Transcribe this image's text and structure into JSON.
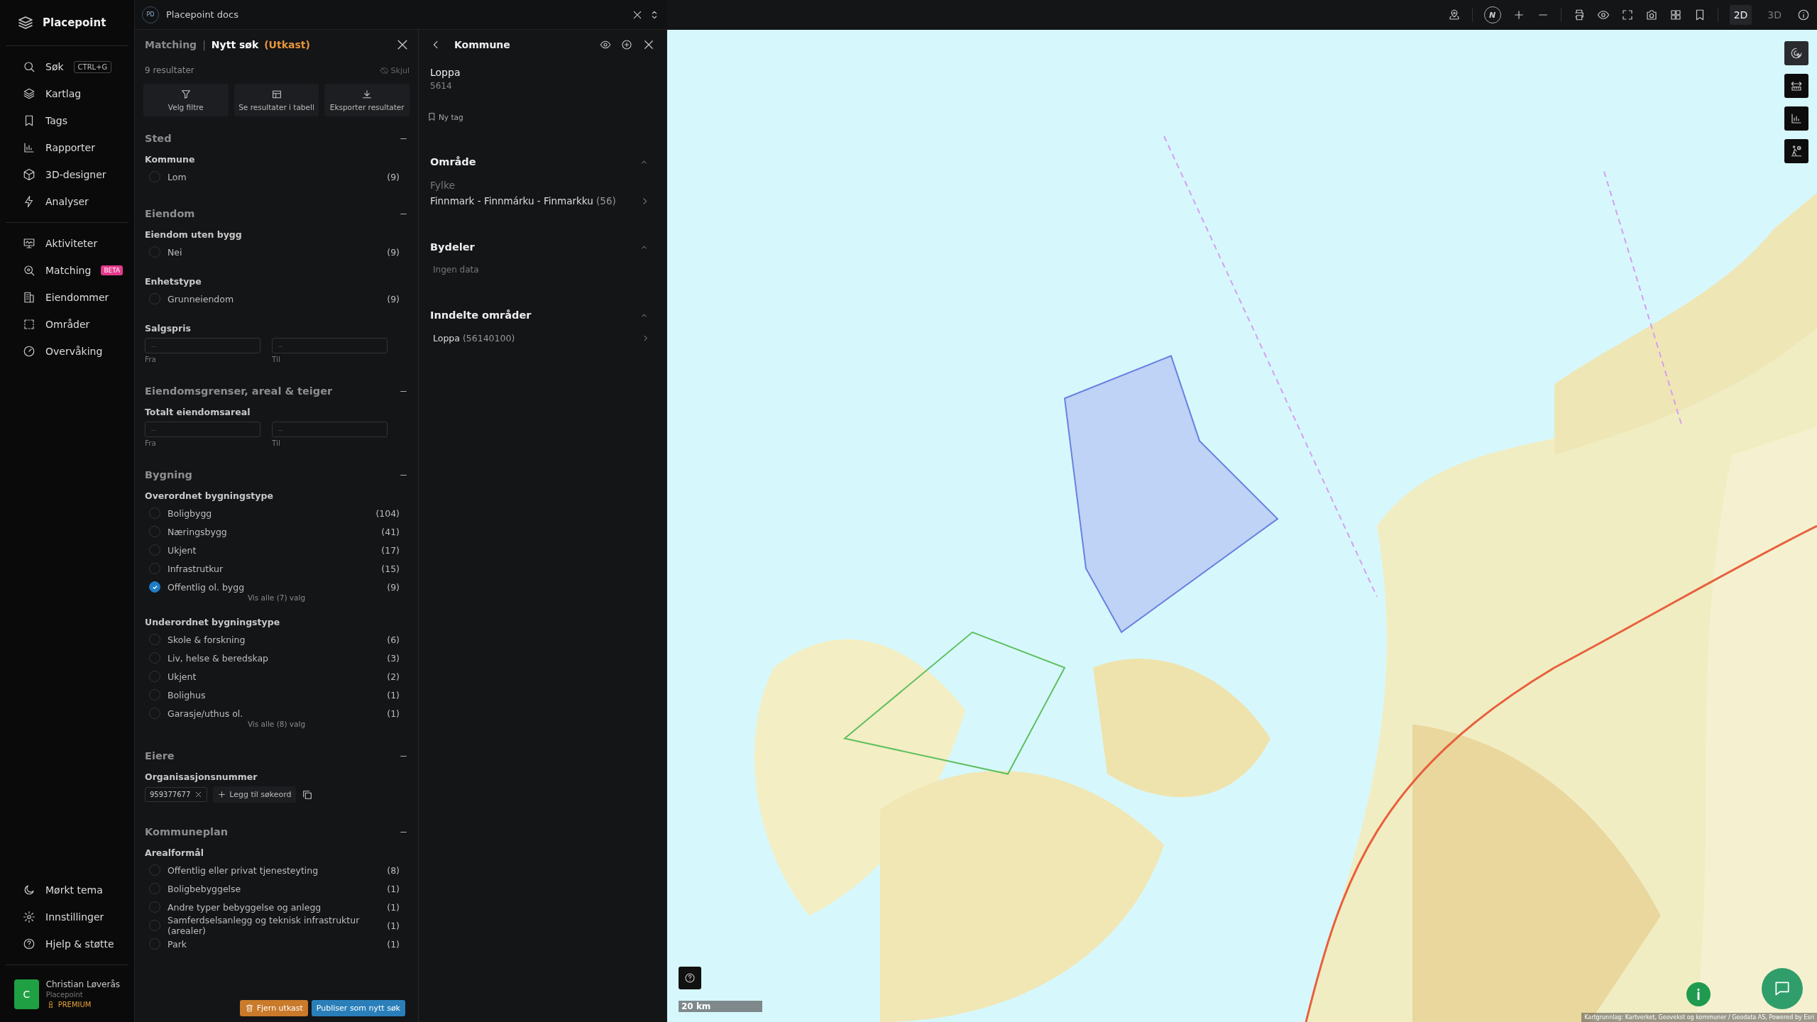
{
  "sidebar": {
    "brand": "Placepoint",
    "nav_groups": [
      [
        {
          "label": "Søk",
          "shortcut": "CTRL+G"
        },
        {
          "label": "Kartlag"
        },
        {
          "label": "Tags"
        },
        {
          "label": "Rapporter"
        },
        {
          "label": "3D-designer"
        },
        {
          "label": "Analyser"
        }
      ],
      [
        {
          "label": "Aktiviteter"
        },
        {
          "label": "Matching",
          "badge": "BETA"
        },
        {
          "label": "Eiendommer"
        },
        {
          "label": "Områder"
        },
        {
          "label": "Overvåking"
        }
      ]
    ],
    "bottom_items": [
      {
        "label": "Mørkt tema"
      },
      {
        "label": "Innstillinger"
      },
      {
        "label": "Hjelp & støtte"
      }
    ],
    "user": {
      "initial": "C",
      "name": "Christian Løverås",
      "org": "Placepoint",
      "plan": "PREMIUM"
    }
  },
  "workspace_tab": {
    "badge": "PD",
    "title": "Placepoint docs"
  },
  "filter_panel": {
    "breadcrumb": "Matching",
    "separator": "|",
    "title": "Nytt søk",
    "status": "(Utkast)",
    "result_count": "9 resultater",
    "hide_label": "Skjul",
    "actions": [
      {
        "label": "Velg filtre"
      },
      {
        "label": "Se resultater i tabell"
      },
      {
        "label": "Eksporter resultater"
      }
    ],
    "sections": [
      {
        "title": "Sted",
        "expanded": true,
        "groups": [
          {
            "kind": "options",
            "title": "Kommune",
            "options": [
              {
                "label": "Lom",
                "count": "(9)",
                "checked": false
              }
            ]
          }
        ]
      },
      {
        "title": "Eiendom",
        "expanded": true,
        "groups": [
          {
            "kind": "options",
            "title": "Eiendom uten bygg",
            "options": [
              {
                "label": "Nei",
                "count": "(9)",
                "checked": false
              }
            ]
          },
          {
            "kind": "options",
            "title": "Enhetstype",
            "options": [
              {
                "label": "Grunneiendom",
                "count": "(9)",
                "checked": false
              }
            ]
          },
          {
            "kind": "range",
            "title": "Salgspris",
            "from_placeholder": "–",
            "from_label": "Fra",
            "to_placeholder": "–",
            "to_label": "Til"
          }
        ]
      },
      {
        "title": "Eiendomsgrenser, areal & teiger",
        "expanded": true,
        "groups": [
          {
            "kind": "range",
            "title": "Totalt eiendomsareal",
            "from_placeholder": "–",
            "from_label": "Fra",
            "to_placeholder": "–",
            "to_label": "Til"
          }
        ]
      },
      {
        "title": "Bygning",
        "expanded": true,
        "groups": [
          {
            "kind": "options",
            "title": "Overordnet bygningstype",
            "show_all": "Vis alle (7) valg",
            "options": [
              {
                "label": "Boligbygg",
                "count": "(104)",
                "checked": false
              },
              {
                "label": "Næringsbygg",
                "count": "(41)",
                "checked": false
              },
              {
                "label": "Ukjent",
                "count": "(17)",
                "checked": false
              },
              {
                "label": "Infrastrutkur",
                "count": "(15)",
                "checked": false
              },
              {
                "label": "Offentlig ol. bygg",
                "count": "(9)",
                "checked": true
              }
            ]
          },
          {
            "kind": "options",
            "title": "Underordnet bygningstype",
            "show_all": "Vis alle (8) valg",
            "options": [
              {
                "label": "Skole & forskning",
                "count": "(6)",
                "checked": false
              },
              {
                "label": "Liv, helse & beredskap",
                "count": "(3)",
                "checked": false
              },
              {
                "label": "Ukjent",
                "count": "(2)",
                "checked": false
              },
              {
                "label": "Bolighus",
                "count": "(1)",
                "checked": false
              },
              {
                "label": "Garasje/uthus ol.",
                "count": "(1)",
                "checked": false
              }
            ]
          }
        ]
      },
      {
        "title": "Eiere",
        "expanded": true,
        "groups": [
          {
            "kind": "tags",
            "title": "Organisasjonsnummer",
            "tags": [
              "959377677"
            ],
            "add_label": "Legg til søkeord"
          }
        ]
      },
      {
        "title": "Kommuneplan",
        "expanded": true,
        "groups": [
          {
            "kind": "options",
            "title": "Arealformål",
            "options": [
              {
                "label": "Offentlig eller privat tjenesteyting",
                "count": "(8)",
                "checked": false
              },
              {
                "label": "Boligbebyggelse",
                "count": "(1)",
                "checked": false
              },
              {
                "label": "Andre typer bebyggelse og anlegg",
                "count": "(1)",
                "checked": false
              },
              {
                "label": "Samferdselsanlegg og teknisk infrastruktur (arealer)",
                "count": "(1)",
                "checked": false
              },
              {
                "label": "Park",
                "count": "(1)",
                "checked": false
              }
            ]
          }
        ]
      }
    ],
    "footer_buttons": [
      {
        "label": "Fjern utkast",
        "kind": "danger"
      },
      {
        "label": "Publiser som nytt søk",
        "kind": "primary"
      }
    ]
  },
  "detail_panel": {
    "title": "Kommune",
    "name": "Loppa",
    "code": "5614",
    "tag_button": "Ny tag",
    "sections": [
      {
        "title": "Område",
        "expanded": true,
        "kind": "field",
        "label": "Fylke",
        "value": "Finnmark - Finnmárku - Finmarkku",
        "count": "(56)"
      },
      {
        "title": "Bydeler",
        "expanded": true,
        "kind": "empty",
        "text": "Ingen data"
      },
      {
        "title": "Inndelte områder",
        "expanded": true,
        "kind": "links",
        "items": [
          {
            "name": "Loppa",
            "code": "(56140100)"
          }
        ]
      }
    ]
  },
  "map": {
    "compass_label": "N",
    "view_modes": [
      {
        "label": "2D",
        "selected": true
      },
      {
        "label": "3D",
        "selected": false
      }
    ],
    "scale": "20 km",
    "attribution": "Kartgrunnlag: Kartverket, Geovekst og kommuner / Geodata AS, Powered by Esri"
  }
}
